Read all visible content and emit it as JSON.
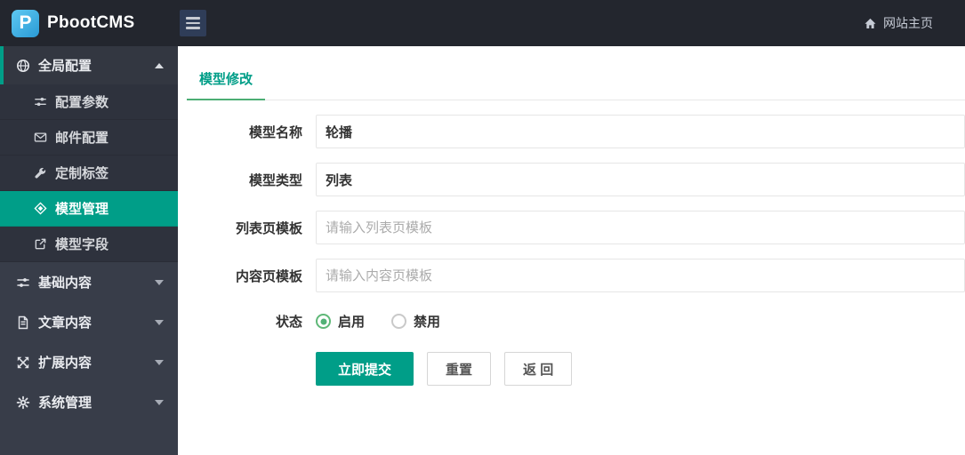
{
  "topbar": {
    "brand": "PbootCMS",
    "logo_letter": "P",
    "menu_icon": "hamburger-menu-icon",
    "home_icon": "home-icon",
    "home_link": "网站主页"
  },
  "sidebar": {
    "items": [
      {
        "label": "全局配置",
        "icon": "globe-icon",
        "state": "expanded",
        "children": [
          {
            "label": "配置参数",
            "icon": "sliders-icon",
            "active": false
          },
          {
            "label": "邮件配置",
            "icon": "mail-icon",
            "active": false
          },
          {
            "label": "定制标签",
            "icon": "wrench-icon",
            "active": false
          },
          {
            "label": "模型管理",
            "icon": "cube-icon",
            "active": true
          },
          {
            "label": "模型字段",
            "icon": "external-link-icon",
            "active": false
          }
        ]
      },
      {
        "label": "基础内容",
        "icon": "sliders-icon",
        "state": "collapsed"
      },
      {
        "label": "文章内容",
        "icon": "document-icon",
        "state": "collapsed"
      },
      {
        "label": "扩展内容",
        "icon": "expand-arrows-icon",
        "state": "collapsed"
      },
      {
        "label": "系统管理",
        "icon": "gear-icon",
        "state": "collapsed"
      }
    ]
  },
  "main": {
    "tab": "模型修改",
    "form": {
      "fields": [
        {
          "label": "模型名称",
          "value": "轮播",
          "placeholder": ""
        },
        {
          "label": "模型类型",
          "value": "列表",
          "placeholder": ""
        },
        {
          "label": "列表页模板",
          "value": "",
          "placeholder": "请输入列表页模板"
        },
        {
          "label": "内容页模板",
          "value": "",
          "placeholder": "请输入内容页模板"
        }
      ],
      "status": {
        "label": "状态",
        "options": [
          {
            "label": "启用",
            "checked": true
          },
          {
            "label": "禁用",
            "checked": false
          }
        ]
      },
      "buttons": [
        {
          "label": "立即提交",
          "style": "primary"
        },
        {
          "label": "重置",
          "style": "default"
        },
        {
          "label": "返 回",
          "style": "default"
        }
      ]
    }
  },
  "colors": {
    "theme_teal": "#009E88",
    "tab_underline_green": "#4CAE74",
    "radio_green": "#5FB878",
    "topbar_bg": "#23262E",
    "sidebar_bg": "#383D49",
    "submenu_bg": "#2E323D",
    "logo_blue": "#3FB0E4"
  }
}
